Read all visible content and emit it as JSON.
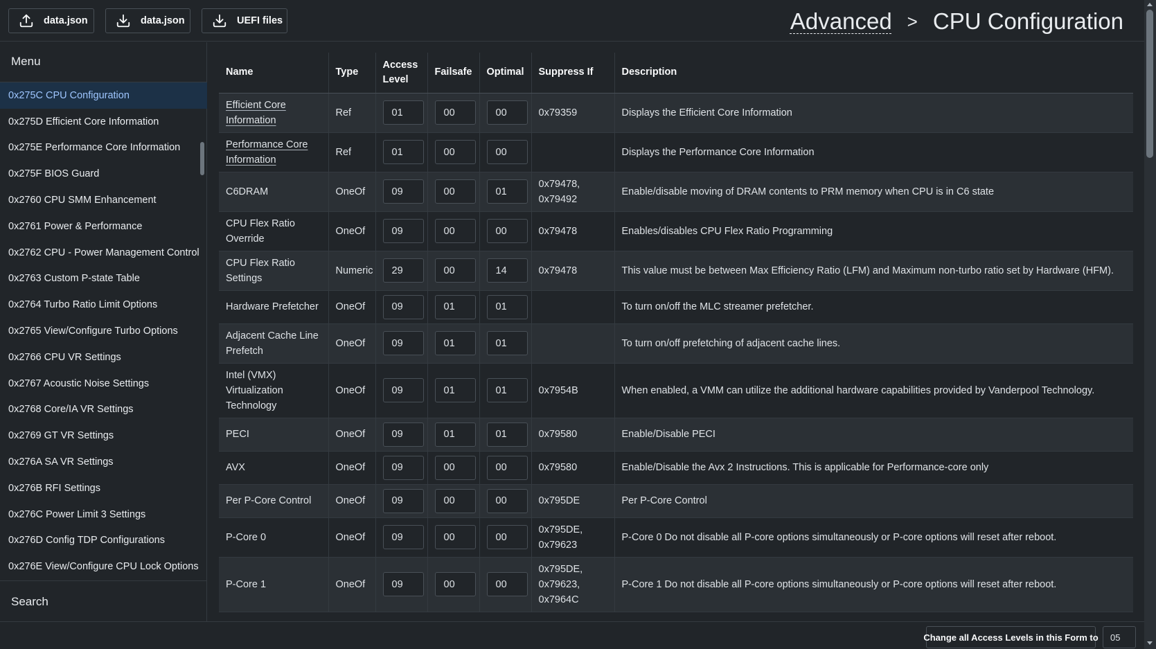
{
  "toolbar": {
    "upload_label": "data.json",
    "download_label": "data.json",
    "uefi_label": "UEFI files"
  },
  "breadcrumb": {
    "parent": "Advanced",
    "separator": ">",
    "current": "CPU Configuration"
  },
  "sidebar": {
    "menu_title": "Menu",
    "search_label": "Search",
    "items": [
      {
        "label": "0x275C CPU Configuration",
        "active": true
      },
      {
        "label": "0x275D Efficient Core Information"
      },
      {
        "label": "0x275E Performance Core Information"
      },
      {
        "label": "0x275F BIOS Guard"
      },
      {
        "label": "0x2760 CPU SMM Enhancement"
      },
      {
        "label": "0x2761 Power & Performance"
      },
      {
        "label": "0x2762 CPU - Power Management Control"
      },
      {
        "label": "0x2763 Custom P-state Table"
      },
      {
        "label": "0x2764 Turbo Ratio Limit Options"
      },
      {
        "label": "0x2765 View/Configure Turbo Options"
      },
      {
        "label": "0x2766 CPU VR Settings"
      },
      {
        "label": "0x2767 Acoustic Noise Settings"
      },
      {
        "label": "0x2768 Core/IA VR Settings"
      },
      {
        "label": "0x2769 GT VR Settings"
      },
      {
        "label": "0x276A SA VR Settings"
      },
      {
        "label": "0x276B RFI Settings"
      },
      {
        "label": "0x276C Power Limit 3 Settings"
      },
      {
        "label": "0x276D Config TDP Configurations"
      },
      {
        "label": "0x276E View/Configure CPU Lock Options"
      }
    ]
  },
  "table": {
    "headers": {
      "name": "Name",
      "type": "Type",
      "access": "Access Level",
      "failsafe": "Failsafe",
      "optimal": "Optimal",
      "suppress": "Suppress If",
      "description": "Description"
    },
    "rows": [
      {
        "name": "Efficient Core Information",
        "link": true,
        "type": "Ref",
        "access": "01",
        "failsafe": "00",
        "optimal": "00",
        "suppress": "0x79359",
        "description": "Displays the Efficient Core Information"
      },
      {
        "name": "Performance Core Information",
        "link": true,
        "type": "Ref",
        "access": "01",
        "failsafe": "00",
        "optimal": "00",
        "suppress": "",
        "description": "Displays the Performance Core Information"
      },
      {
        "name": "C6DRAM",
        "type": "OneOf",
        "access": "09",
        "failsafe": "00",
        "optimal": "01",
        "suppress": "0x79478, 0x79492",
        "description": "Enable/disable moving of DRAM contents to PRM memory when CPU is in C6 state"
      },
      {
        "name": "CPU Flex Ratio Override",
        "type": "OneOf",
        "access": "09",
        "failsafe": "00",
        "optimal": "00",
        "suppress": "0x79478",
        "description": "Enables/disables CPU Flex Ratio Programming"
      },
      {
        "name": "CPU Flex Ratio Settings",
        "type": "Numeric",
        "access": "29",
        "failsafe": "00",
        "optimal": "14",
        "suppress": "0x79478",
        "description": "This value must be between Max Efficiency Ratio (LFM) and Maximum non-turbo ratio set by Hardware (HFM)."
      },
      {
        "name": "Hardware Prefetcher",
        "type": "OneOf",
        "access": "09",
        "failsafe": "01",
        "optimal": "01",
        "suppress": "",
        "description": "To turn on/off the MLC streamer prefetcher."
      },
      {
        "name": "Adjacent Cache Line Prefetch",
        "type": "OneOf",
        "access": "09",
        "failsafe": "01",
        "optimal": "01",
        "suppress": "",
        "description": "To turn on/off prefetching of adjacent cache lines."
      },
      {
        "name": "Intel (VMX) Virtualization Technology",
        "type": "OneOf",
        "access": "09",
        "failsafe": "01",
        "optimal": "01",
        "suppress": "0x7954B",
        "description": "When enabled, a VMM can utilize the additional hardware capabilities provided by Vanderpool Technology."
      },
      {
        "name": "PECI",
        "type": "OneOf",
        "access": "09",
        "failsafe": "01",
        "optimal": "01",
        "suppress": "0x79580",
        "description": "Enable/Disable PECI"
      },
      {
        "name": "AVX",
        "type": "OneOf",
        "access": "09",
        "failsafe": "00",
        "optimal": "00",
        "suppress": "0x79580",
        "description": "Enable/Disable the Avx 2 Instructions. This is applicable for Performance-core only"
      },
      {
        "name": "Per P-Core Control",
        "type": "OneOf",
        "access": "09",
        "failsafe": "00",
        "optimal": "00",
        "suppress": "0x795DE",
        "description": "Per P-Core Control"
      },
      {
        "name": "P-Core 0",
        "type": "OneOf",
        "access": "09",
        "failsafe": "00",
        "optimal": "00",
        "suppress": "0x795DE, 0x79623",
        "description": "P-Core 0 Do not disable all P-core options simultaneously or P-core options will reset after reboot."
      },
      {
        "name": "P-Core 1",
        "type": "OneOf",
        "access": "09",
        "failsafe": "00",
        "optimal": "00",
        "suppress": "0x795DE, 0x79623, 0x7964C",
        "description": "P-Core 1 Do not disable all P-core options simultaneously or P-core options will reset after reboot."
      }
    ]
  },
  "bottom": {
    "change_all_label": "Change all Access Levels in this Form to",
    "access_value": "05"
  },
  "icons": {
    "upload": "upload-icon",
    "download": "download-icon"
  },
  "colors": {
    "background": "#212529",
    "active_menu": "#1c3147",
    "active_menu_text": "#9ec5fe",
    "border": "#495057"
  }
}
